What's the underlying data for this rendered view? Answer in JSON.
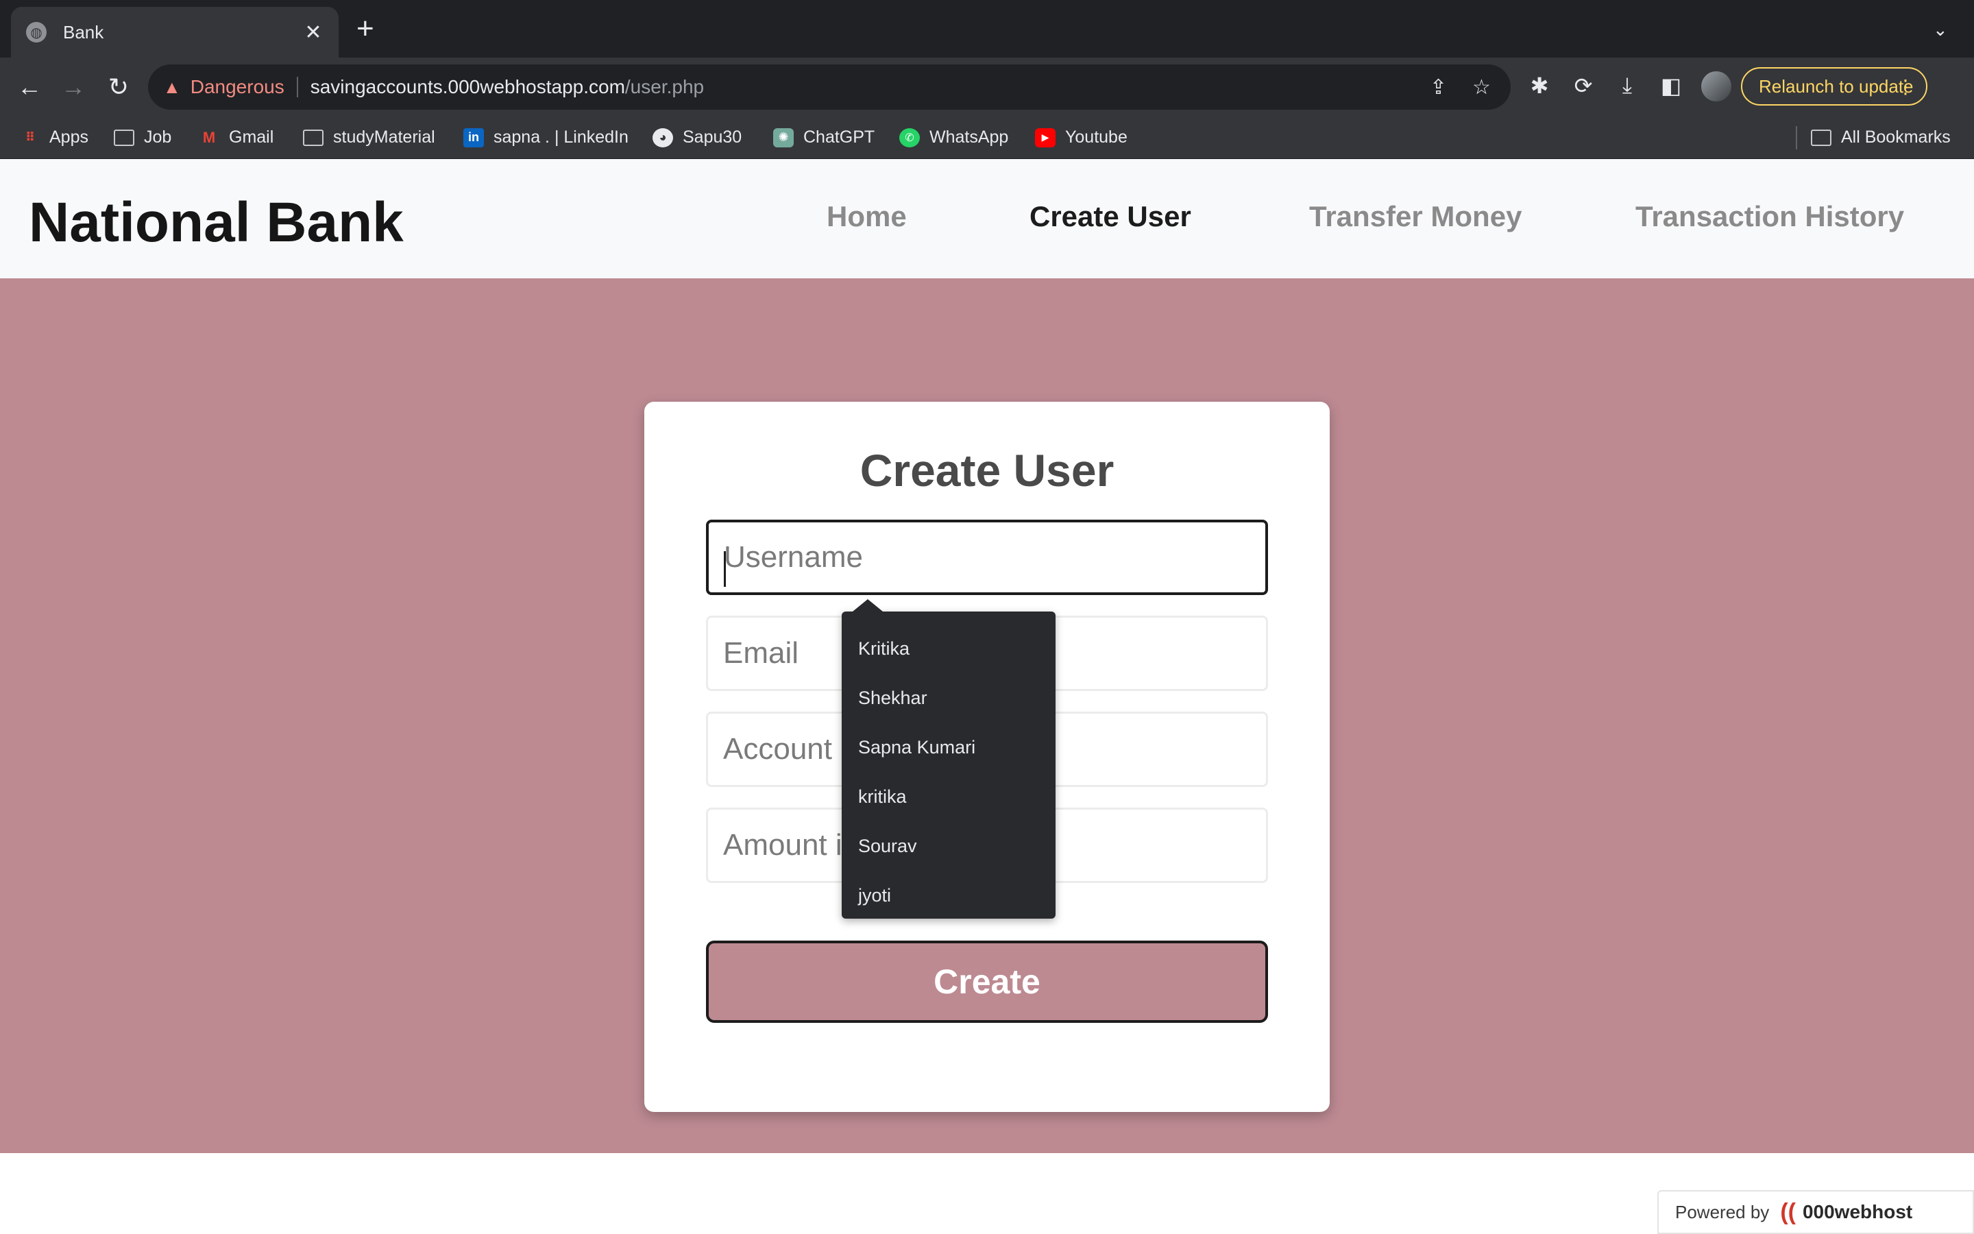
{
  "browser": {
    "tab": {
      "title": "Bank",
      "close": "✕"
    },
    "new_tab": "+",
    "omnibox": {
      "security_label": "Dangerous",
      "url_host": "savingaccounts.000webhostapp.com",
      "url_path": "/user.php"
    },
    "relaunch_label": "Relaunch to update",
    "bookmarks": [
      {
        "label": "Apps",
        "icon": "apps-grid-icon"
      },
      {
        "label": "Job",
        "icon": "folder-icon"
      },
      {
        "label": "Gmail",
        "icon": "gmail-icon"
      },
      {
        "label": "studyMaterial",
        "icon": "folder-icon"
      },
      {
        "label": "sapna . | LinkedIn",
        "icon": "linkedin-icon"
      },
      {
        "label": "Sapu30",
        "icon": "github-icon"
      },
      {
        "label": "ChatGPT",
        "icon": "chatgpt-icon"
      },
      {
        "label": "WhatsApp",
        "icon": "whatsapp-icon"
      },
      {
        "label": "Youtube",
        "icon": "youtube-icon"
      }
    ],
    "all_bookmarks": "All Bookmarks"
  },
  "page": {
    "brand": "National Bank",
    "nav": [
      "Home",
      "Create User",
      "Transfer Money",
      "Transaction History"
    ],
    "active_nav": "Create User",
    "form": {
      "title": "Create User",
      "username_placeholder": "Username",
      "email_placeholder": "Email",
      "account_placeholder": "Account N",
      "amount_placeholder": "Amount in",
      "submit_label": "Create"
    },
    "autocomplete": [
      "Kritika",
      "Shekhar",
      "Sapna Kumari",
      "kritika",
      "Sourav",
      "jyoti"
    ],
    "footer": {
      "powered_by": "Powered by",
      "brand": "000webhost"
    }
  },
  "colors": {
    "hero_bg": "#bd8a92",
    "danger": "#f28b82",
    "relaunch": "#fdd663"
  }
}
